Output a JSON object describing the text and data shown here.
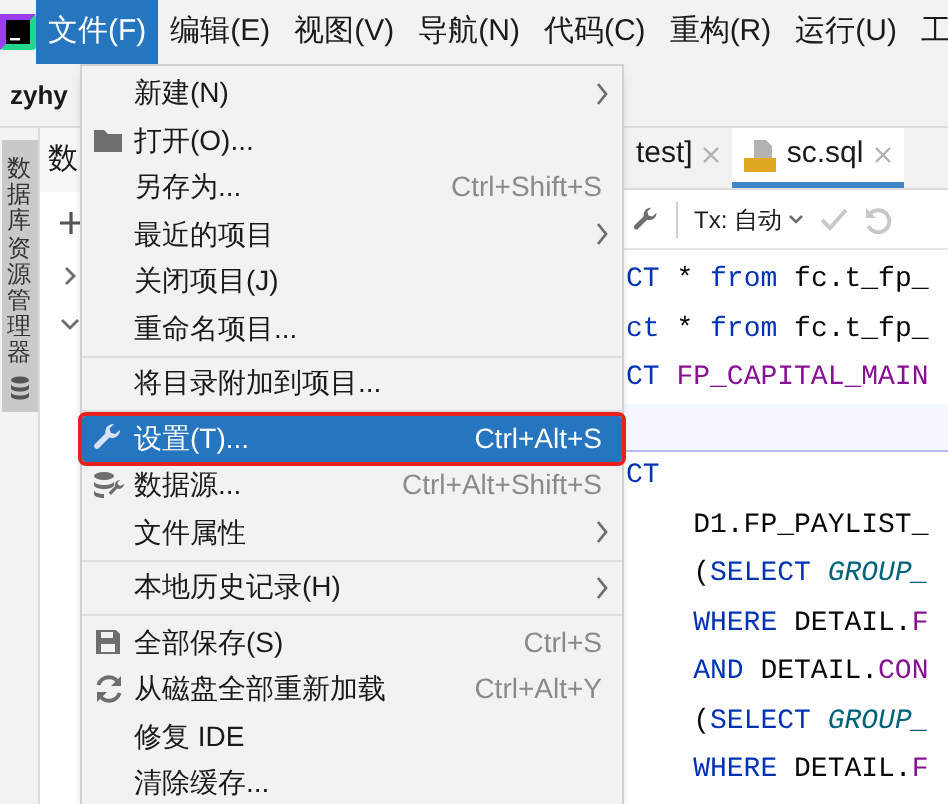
{
  "menubar": {
    "items": [
      {
        "label": "文件(F)",
        "selected": true
      },
      {
        "label": "编辑(E)",
        "selected": false
      },
      {
        "label": "视图(V)",
        "selected": false
      },
      {
        "label": "导航(N)",
        "selected": false
      },
      {
        "label": "代码(C)",
        "selected": false
      },
      {
        "label": "重构(R)",
        "selected": false
      },
      {
        "label": "运行(U)",
        "selected": false
      },
      {
        "label": "工",
        "selected": false
      }
    ]
  },
  "project": {
    "name": "zyhy"
  },
  "tool_strip": {
    "tab": "数据库资源管理器"
  },
  "db_panel": {
    "title": "数",
    "tree": [
      {
        "expanded": false
      },
      {
        "expanded": true
      }
    ]
  },
  "file_menu": {
    "items": [
      {
        "kind": "item",
        "label": "新建(N)",
        "submenu": true,
        "selected": false,
        "outlined": false
      },
      {
        "kind": "item",
        "label": "打开(O)...",
        "submenu": false,
        "selected": false,
        "outlined": false
      },
      {
        "kind": "item",
        "label": "另存为...",
        "shortcut": "Ctrl+Shift+S",
        "submenu": false,
        "selected": false,
        "outlined": false
      },
      {
        "kind": "item",
        "label": "最近的项目",
        "submenu": true,
        "selected": false,
        "outlined": false
      },
      {
        "kind": "item",
        "label": "关闭项目(J)",
        "submenu": false,
        "selected": false,
        "outlined": false
      },
      {
        "kind": "item",
        "label": "重命名项目...",
        "submenu": false,
        "selected": false,
        "outlined": false
      },
      {
        "kind": "separator"
      },
      {
        "kind": "item",
        "label": "将目录附加到项目...",
        "submenu": false,
        "selected": false,
        "outlined": false
      },
      {
        "kind": "separator"
      },
      {
        "kind": "item",
        "label": "设置(T)...",
        "shortcut": "Ctrl+Alt+S",
        "submenu": false,
        "selected": true,
        "outlined": true
      },
      {
        "kind": "item",
        "label": "数据源...",
        "shortcut": "Ctrl+Alt+Shift+S",
        "submenu": false,
        "selected": false,
        "outlined": false
      },
      {
        "kind": "item",
        "label": "文件属性",
        "submenu": true,
        "selected": false,
        "outlined": false
      },
      {
        "kind": "separator"
      },
      {
        "kind": "item",
        "label": "本地历史记录(H)",
        "submenu": true,
        "selected": false,
        "outlined": false
      },
      {
        "kind": "separator"
      },
      {
        "kind": "item",
        "label": "全部保存(S)",
        "shortcut": "Ctrl+S",
        "submenu": false,
        "selected": false,
        "outlined": false
      },
      {
        "kind": "item",
        "label": "从磁盘全部重新加载",
        "shortcut": "Ctrl+Alt+Y",
        "submenu": false,
        "selected": false,
        "outlined": false
      },
      {
        "kind": "item",
        "label": "修复 IDE",
        "submenu": false,
        "selected": false,
        "outlined": false
      },
      {
        "kind": "item",
        "label": "清除缓存...",
        "submenu": false,
        "selected": false,
        "outlined": false
      }
    ]
  },
  "editor": {
    "tabs": [
      {
        "label": "test]",
        "selected": false
      },
      {
        "label": "sc.sql",
        "selected": true
      }
    ],
    "toolbar": {
      "tx_label": "Tx: 自动"
    },
    "lines": [
      {
        "current": false,
        "tokens": [
          {
            "t": "CT",
            "kind": "keyword"
          },
          {
            "t": " * ",
            "kind": "plain"
          },
          {
            "t": "from",
            "kind": "keyword"
          },
          {
            "t": " fc.t_fp_",
            "kind": "plain"
          }
        ]
      },
      {
        "current": false,
        "tokens": [
          {
            "t": "ct",
            "kind": "keyword"
          },
          {
            "t": " * ",
            "kind": "plain"
          },
          {
            "t": "from",
            "kind": "keyword"
          },
          {
            "t": " fc.t_fp_",
            "kind": "plain"
          }
        ]
      },
      {
        "current": false,
        "tokens": [
          {
            "t": "CT",
            "kind": "keyword"
          },
          {
            "t": " FP_CAPITAL_MAIN",
            "kind": "column"
          }
        ]
      },
      {
        "current": true
      },
      {
        "current": false,
        "tokens": [
          {
            "t": "CT",
            "kind": "keyword"
          }
        ]
      },
      {
        "current": false,
        "tokens": [
          {
            "t": "    D1.FP_PAYLIST_",
            "kind": "plain"
          }
        ]
      },
      {
        "current": false,
        "tokens": [
          {
            "t": "    (",
            "kind": "plain"
          },
          {
            "t": "SELECT",
            "kind": "keyword"
          },
          {
            "t": " GROUP_",
            "kind": "function"
          }
        ]
      },
      {
        "current": false,
        "tokens": [
          {
            "t": "    WHERE",
            "kind": "keyword"
          },
          {
            "t": " DETAIL.",
            "kind": "plain"
          },
          {
            "t": "F",
            "kind": "column"
          }
        ]
      },
      {
        "current": false,
        "tokens": [
          {
            "t": "    AND",
            "kind": "keyword"
          },
          {
            "t": " DETAIL.",
            "kind": "plain"
          },
          {
            "t": "CON",
            "kind": "column"
          }
        ]
      },
      {
        "current": false,
        "tokens": [
          {
            "t": "    (",
            "kind": "plain"
          },
          {
            "t": "SELECT",
            "kind": "keyword"
          },
          {
            "t": " GROUP_",
            "kind": "function"
          }
        ]
      },
      {
        "current": false,
        "tokens": [
          {
            "t": "    WHERE",
            "kind": "keyword"
          },
          {
            "t": " DETAIL.",
            "kind": "plain"
          },
          {
            "t": "F",
            "kind": "column"
          }
        ]
      }
    ]
  }
}
